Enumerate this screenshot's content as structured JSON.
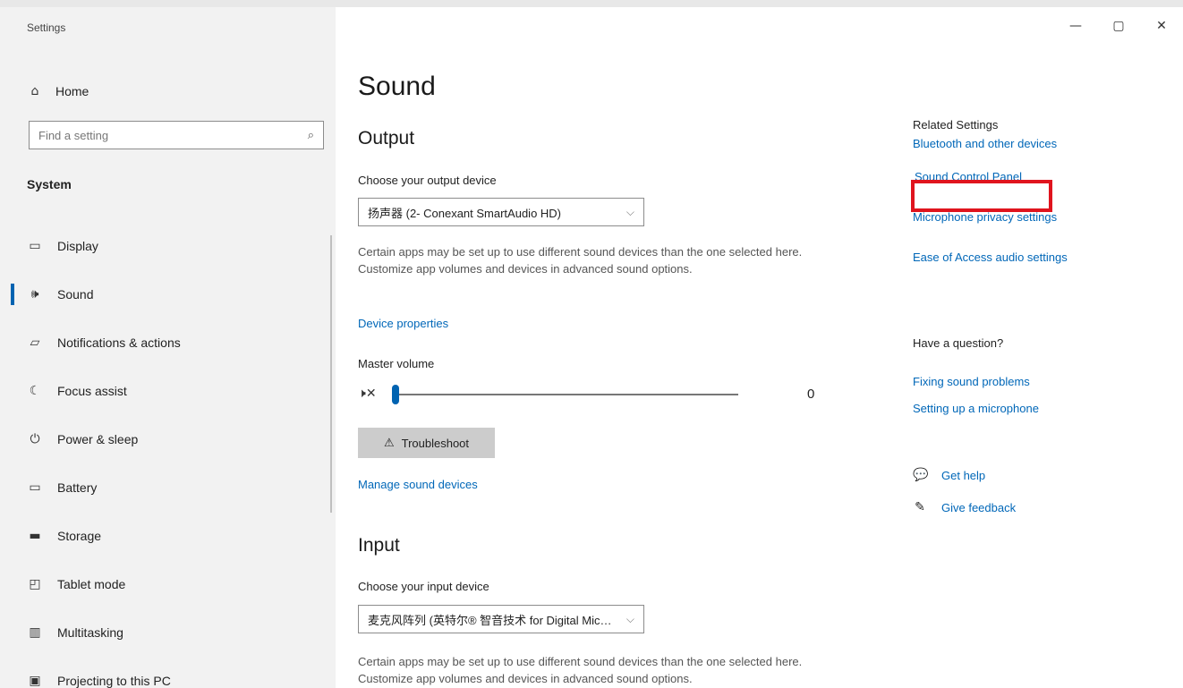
{
  "window": {
    "title": "Settings",
    "controls": {
      "minimize": "—",
      "maximize": "▢",
      "close": "✕"
    }
  },
  "sidebar": {
    "home_label": "Home",
    "search_placeholder": "Find a setting",
    "section_label": "System",
    "items": [
      {
        "label": "Display",
        "icon": "monitor-icon",
        "glyph": "▭"
      },
      {
        "label": "Sound",
        "icon": "speaker-icon",
        "glyph": "🕪",
        "selected": true
      },
      {
        "label": "Notifications & actions",
        "icon": "notification-icon",
        "glyph": "▱"
      },
      {
        "label": "Focus assist",
        "icon": "moon-icon",
        "glyph": "☾"
      },
      {
        "label": "Power & sleep",
        "icon": "power-icon",
        "glyph": "⏻"
      },
      {
        "label": "Battery",
        "icon": "battery-icon",
        "glyph": "▭"
      },
      {
        "label": "Storage",
        "icon": "storage-icon",
        "glyph": "▬"
      },
      {
        "label": "Tablet mode",
        "icon": "tablet-icon",
        "glyph": "◰"
      },
      {
        "label": "Multitasking",
        "icon": "multitasking-icon",
        "glyph": "▥"
      },
      {
        "label": "Projecting to this PC",
        "icon": "projecting-icon",
        "glyph": "▣"
      }
    ]
  },
  "main": {
    "title": "Sound",
    "output": {
      "heading": "Output",
      "choose_label": "Choose your output device",
      "device": "扬声器 (2- Conexant SmartAudio HD)",
      "description": "Certain apps may be set up to use different sound devices than the one selected here. Customize app volumes and devices in advanced sound options.",
      "device_properties_link": "Device properties",
      "master_volume_label": "Master volume",
      "volume_value": "0",
      "troubleshoot_label": "Troubleshoot",
      "manage_link": "Manage sound devices"
    },
    "input": {
      "heading": "Input",
      "choose_label": "Choose your input device",
      "device": "麦克风阵列 (英特尔® 智音技术 for Digital Microphones)",
      "description": "Certain apps may be set up to use different sound devices than the one selected here. Customize app volumes and devices in advanced sound options."
    }
  },
  "related": {
    "heading": "Related Settings",
    "links": [
      "Bluetooth and other devices",
      "Sound Control Panel",
      "Microphone privacy settings",
      "Ease of Access audio settings"
    ],
    "question_heading": "Have a question?",
    "question_links": [
      "Fixing sound problems",
      "Setting up a microphone"
    ],
    "get_help": "Get help",
    "give_feedback": "Give feedback"
  },
  "colors": {
    "accent": "#0063b1",
    "link": "#0067b8",
    "highlight": "#e0141e",
    "sidebar_bg": "#f2f2f2"
  }
}
